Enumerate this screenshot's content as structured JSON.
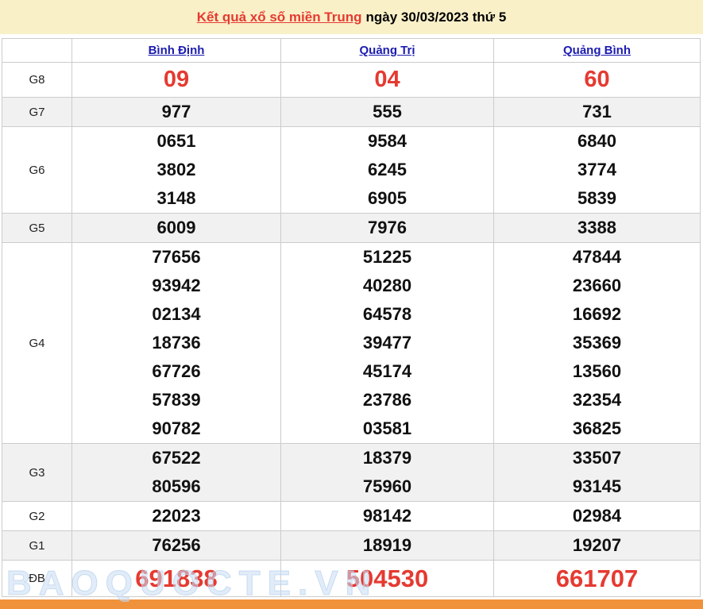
{
  "header": {
    "title_link": "Kết quả xổ số miền Trung",
    "title_rest": "ngày 30/03/2023 thứ 5"
  },
  "table": {
    "columns": [
      "Bình Định",
      "Quảng Trị",
      "Quảng Bình"
    ],
    "rows": [
      {
        "label": "G8",
        "highlight": true,
        "values": [
          [
            "09"
          ],
          [
            "04"
          ],
          [
            "60"
          ]
        ]
      },
      {
        "label": "G7",
        "highlight": false,
        "values": [
          [
            "977"
          ],
          [
            "555"
          ],
          [
            "731"
          ]
        ]
      },
      {
        "label": "G6",
        "highlight": false,
        "values": [
          [
            "0651",
            "3802",
            "3148"
          ],
          [
            "9584",
            "6245",
            "6905"
          ],
          [
            "6840",
            "3774",
            "5839"
          ]
        ]
      },
      {
        "label": "G5",
        "highlight": false,
        "values": [
          [
            "6009"
          ],
          [
            "7976"
          ],
          [
            "3388"
          ]
        ]
      },
      {
        "label": "G4",
        "highlight": false,
        "values": [
          [
            "77656",
            "93942",
            "02134",
            "18736",
            "67726",
            "57839",
            "90782"
          ],
          [
            "51225",
            "40280",
            "64578",
            "39477",
            "45174",
            "23786",
            "03581"
          ],
          [
            "47844",
            "23660",
            "16692",
            "35369",
            "13560",
            "32354",
            "36825"
          ]
        ]
      },
      {
        "label": "G3",
        "highlight": false,
        "values": [
          [
            "67522",
            "80596"
          ],
          [
            "18379",
            "75960"
          ],
          [
            "33507",
            "93145"
          ]
        ]
      },
      {
        "label": "G2",
        "highlight": false,
        "values": [
          [
            "22023"
          ],
          [
            "98142"
          ],
          [
            "02984"
          ]
        ]
      },
      {
        "label": "G1",
        "highlight": false,
        "values": [
          [
            "76256"
          ],
          [
            "18919"
          ],
          [
            "19207"
          ]
        ]
      },
      {
        "label": "ĐB",
        "highlight": true,
        "values": [
          [
            "691838"
          ],
          [
            "504530"
          ],
          [
            "661707"
          ]
        ]
      }
    ]
  },
  "watermark": "BAOQUOCTE.VN",
  "colors": {
    "banner_bg": "#faf0c8",
    "highlight_red": "#e53a31",
    "link_blue": "#1c1cb0",
    "row_stripe": "#f1f1f1",
    "border_gray": "#cccccc",
    "bottom_bar_orange": "#f0923c"
  }
}
